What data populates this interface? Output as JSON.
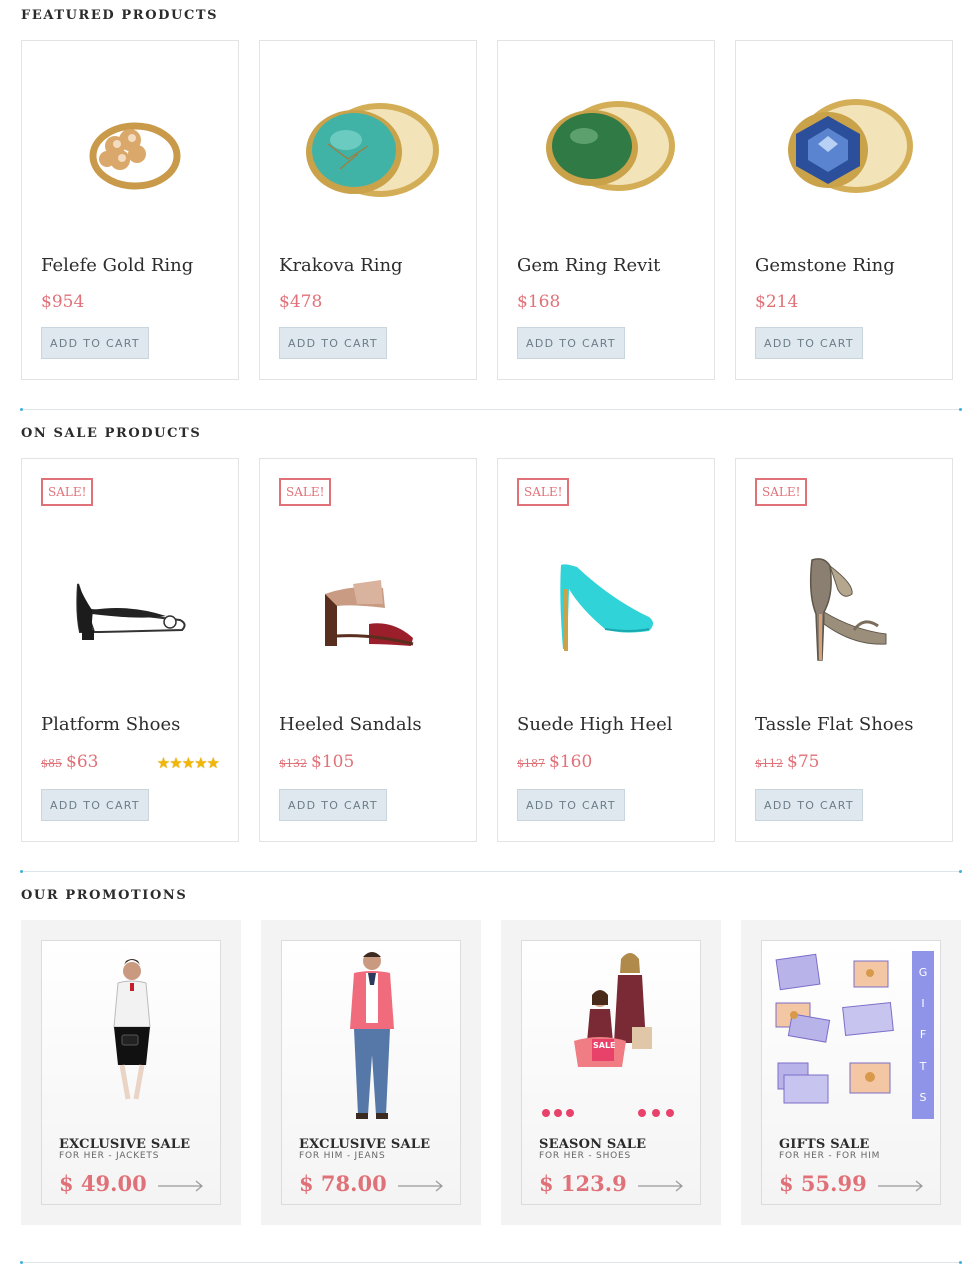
{
  "featured": {
    "title": "FEATURED PRODUCTS",
    "products": [
      {
        "name": "Felefe Gold Ring",
        "price": "$954",
        "cart_label": "ADD TO CART"
      },
      {
        "name": "Krakova Ring",
        "price": "$478",
        "cart_label": "ADD TO CART"
      },
      {
        "name": "Gem Ring Revit",
        "price": "$168",
        "cart_label": "ADD TO CART"
      },
      {
        "name": "Gemstone Ring",
        "price": "$214",
        "cart_label": "ADD TO CART"
      }
    ]
  },
  "sale": {
    "title": "ON SALE PRODUCTS",
    "products": [
      {
        "badge": "SALE!",
        "name": "Platform Shoes",
        "old_price": "$85",
        "price": "$63",
        "cart_label": "ADD TO CART",
        "rating": 5
      },
      {
        "badge": "SALE!",
        "name": "Heeled Sandals",
        "old_price": "$132",
        "price": "$105",
        "cart_label": "ADD TO CART"
      },
      {
        "badge": "SALE!",
        "name": "Suede High Heel",
        "old_price": "$187",
        "price": "$160",
        "cart_label": "ADD TO CART"
      },
      {
        "badge": "SALE!",
        "name": "Tassle Flat Shoes",
        "old_price": "$112",
        "price": "$75",
        "cart_label": "ADD TO CART"
      }
    ]
  },
  "promotions": {
    "title": "OUR PROMOTIONS",
    "items": [
      {
        "title": "EXCLUSIVE SALE",
        "subtitle": "FOR HER - JACKETS",
        "price": "$ 49.00"
      },
      {
        "title": "EXCLUSIVE SALE",
        "subtitle": "FOR HIM - JEANS",
        "price": "$ 78.00"
      },
      {
        "title": "SEASON SALE",
        "subtitle": "FOR HER - SHOES",
        "price": "$ 123.9",
        "tag": "SALE"
      },
      {
        "title": "GIFTS SALE",
        "subtitle": "FOR HER - FOR HIM",
        "price": "$ 55.99",
        "banner": [
          "G",
          "I",
          "F",
          "T",
          "S"
        ]
      }
    ]
  },
  "colors": {
    "accent": "#e07178",
    "button_bg": "#dfe8ee",
    "divider_dot": "#3fb3d8"
  }
}
